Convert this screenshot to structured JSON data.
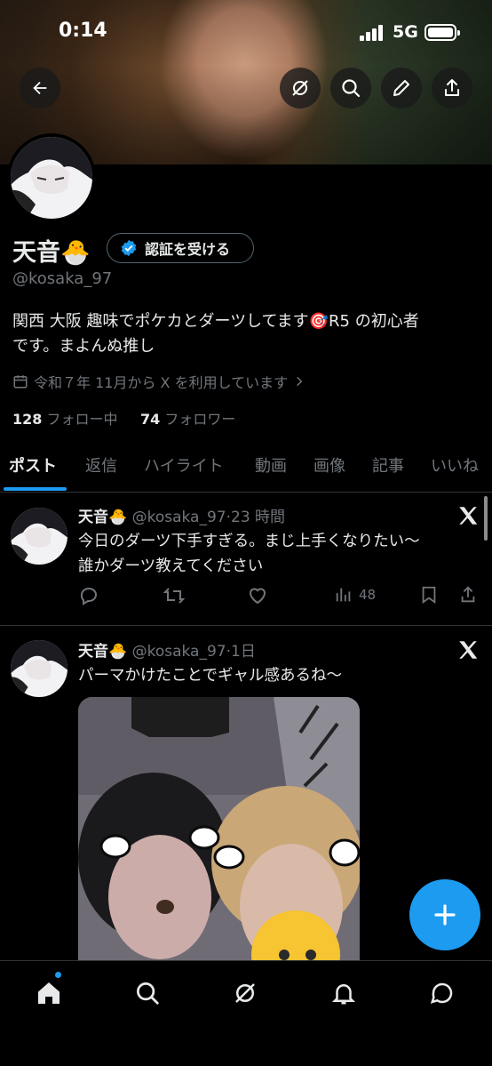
{
  "status_bar": {
    "time": "0:14",
    "network": "5G"
  },
  "profile": {
    "display_name": "天音",
    "name_emoji": "🐣",
    "verify_button_label": "認証を受ける",
    "handle": "@kosaka_97",
    "bio_line1": "関西 大阪 趣味でポケカとダーツしてます🎯R5 の初心者",
    "bio_line2": "です。まよんぬ推し",
    "joined": "令和７年 11月から X を利用しています",
    "following_count": "128",
    "following_label": "フォロー中",
    "followers_count": "74",
    "followers_label": "フォロワー"
  },
  "tabs": [
    "ポスト",
    "返信",
    "ハイライト",
    "動画",
    "画像",
    "記事",
    "いいね"
  ],
  "posts": [
    {
      "name": "天音",
      "emoji": "🐣",
      "handle": "@kosaka_97",
      "time": "23 時間",
      "text_line1": "今日のダーツ下手すぎる。まじ上手くなりたい〜",
      "text_line2": "誰かダーツ教えてください",
      "views": "48"
    },
    {
      "name": "天音",
      "emoji": "🐣",
      "handle": "@kosaka_97",
      "time": "1日",
      "text_line1": "パーマかけたことでギャル感あるね〜"
    }
  ],
  "colors": {
    "accent": "#1d9bf0",
    "muted": "#71767b",
    "text": "#e7e9ea",
    "border": "#2f3336"
  }
}
